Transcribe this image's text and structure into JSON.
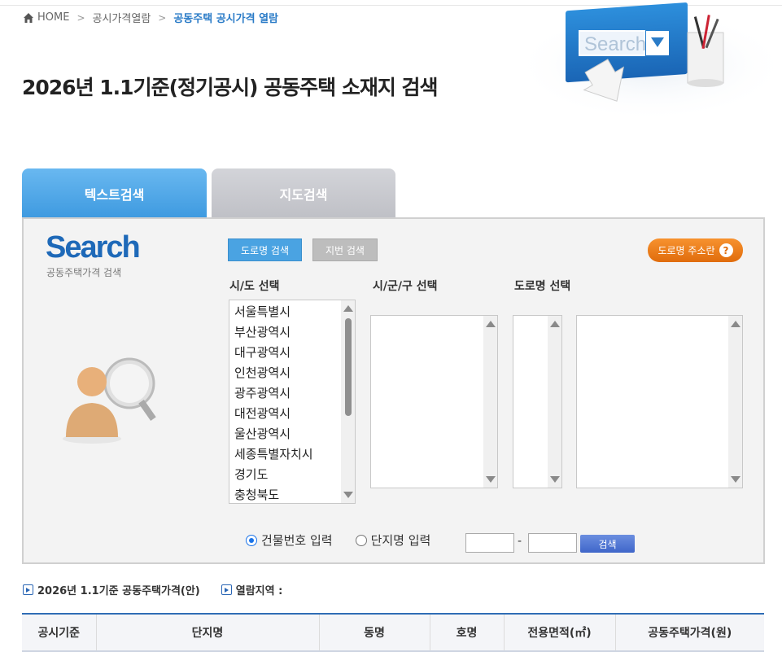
{
  "breadcrumb": {
    "home": "HOME",
    "level1": "공시가격열람",
    "current": "공동주택 공시가격 열람"
  },
  "page_title": "2026년 1.1기준(정기공시) 공동주택 소재지 검색",
  "header_illust": {
    "search_text": "Search"
  },
  "tabs": [
    {
      "label": "텍스트검색",
      "active": true
    },
    {
      "label": "지도검색",
      "active": false
    }
  ],
  "search_logo": {
    "title": "Search",
    "subtitle": "공동주택가격 검색"
  },
  "search_mode": {
    "road": "도로명 검색",
    "lot": "지번 검색"
  },
  "addr_help": {
    "label": "도로명 주소란",
    "icon": "?"
  },
  "labels": {
    "sido": "시/도 선택",
    "sigungu": "시/군/구 선택",
    "road": "도로명 선택"
  },
  "sido_options": [
    "서울특별시",
    "부산광역시",
    "대구광역시",
    "인천광역시",
    "광주광역시",
    "대전광역시",
    "울산광역시",
    "세종특별자치시",
    "경기도",
    "충청북도"
  ],
  "radios": [
    {
      "label": "건물번호 입력",
      "checked": true
    },
    {
      "label": "단지명 입력",
      "checked": false
    }
  ],
  "dash": "-",
  "search_button": "검색",
  "info": {
    "price_label": "2026년 1.1기준 공동주택가격(안)",
    "region_label": "열람지역 :"
  },
  "table_headers": [
    "공시기준",
    "단지명",
    "동명",
    "호명",
    "전용면적(㎡)",
    "공동주택가격(원)"
  ],
  "colors": {
    "accent_blue": "#2a7bc7",
    "tab_active": "#4aa3e2",
    "tab_inactive": "#c6c7cc",
    "addr_button": "#f08a22"
  }
}
